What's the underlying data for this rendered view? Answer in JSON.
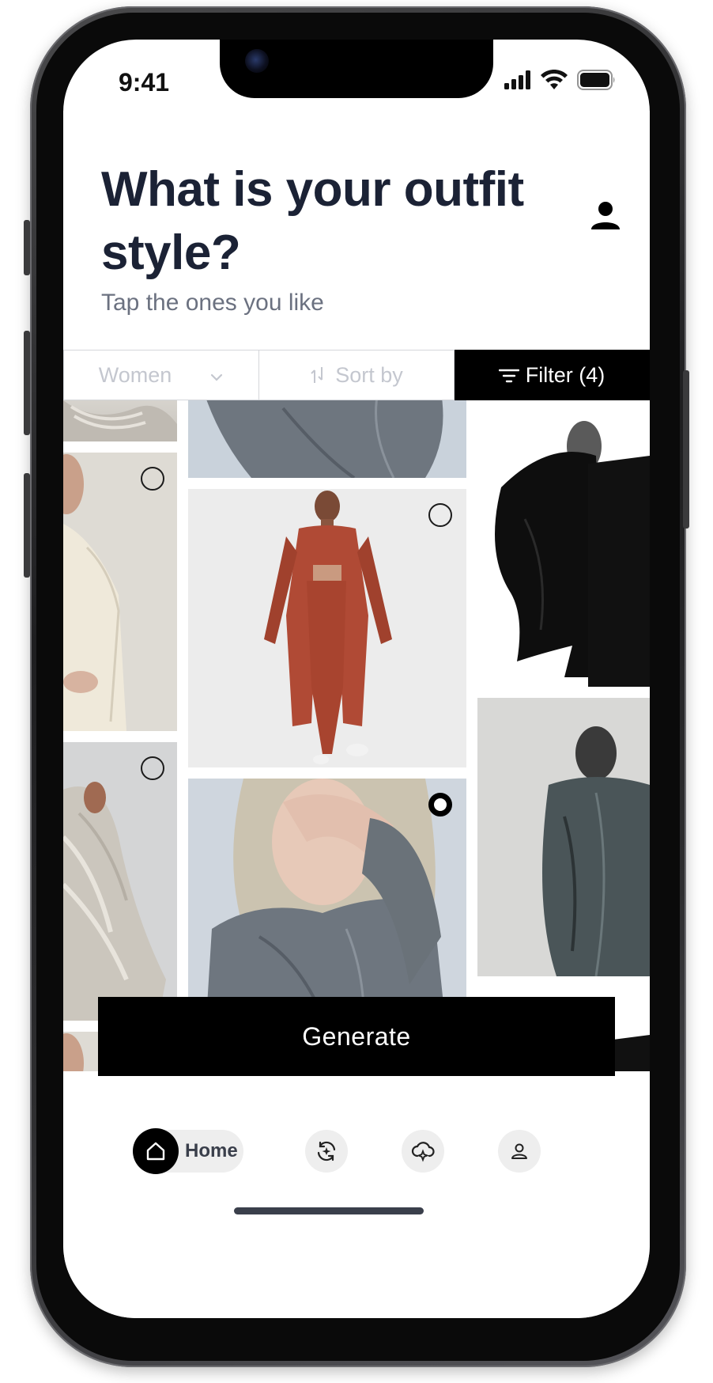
{
  "status_bar": {
    "time": "9:41"
  },
  "header": {
    "title": "What is your outfit style?",
    "subtitle": "Tap the ones you like"
  },
  "filters": {
    "gender": "Women",
    "sort": "Sort by",
    "filter": "Filter (4)"
  },
  "grid": {
    "selected_tile": "center-column-grey-jacket",
    "tiles": [
      {
        "name": "knit-sweater-top",
        "selected": false
      },
      {
        "name": "cream-blazer",
        "selected": false
      },
      {
        "name": "grey-knit-sweater",
        "selected": false
      },
      {
        "name": "cream-blazer-repeat",
        "selected": false
      },
      {
        "name": "grey-jacket-top",
        "selected": false
      },
      {
        "name": "rust-set",
        "selected": false
      },
      {
        "name": "grey-oversized-jacket",
        "selected": true
      },
      {
        "name": "rust-set-repeat",
        "selected": false
      },
      {
        "name": "black-coat",
        "selected": false
      },
      {
        "name": "leather-jacket",
        "selected": false
      },
      {
        "name": "black-coat-repeat",
        "selected": false
      }
    ]
  },
  "actions": {
    "generate_label": "Generate"
  },
  "bottom_nav": {
    "home_label": "Home",
    "items": [
      "home-icon",
      "style-refresh-icon",
      "cloud-sparkle-icon",
      "profile-icon"
    ]
  },
  "colors": {
    "title": "#1b2235",
    "subtitle": "#6b7180",
    "accent": "#000000",
    "muted_filter": "#c4c7cf",
    "rust": "#b04a35",
    "grey_jacket": "#6e767f"
  }
}
